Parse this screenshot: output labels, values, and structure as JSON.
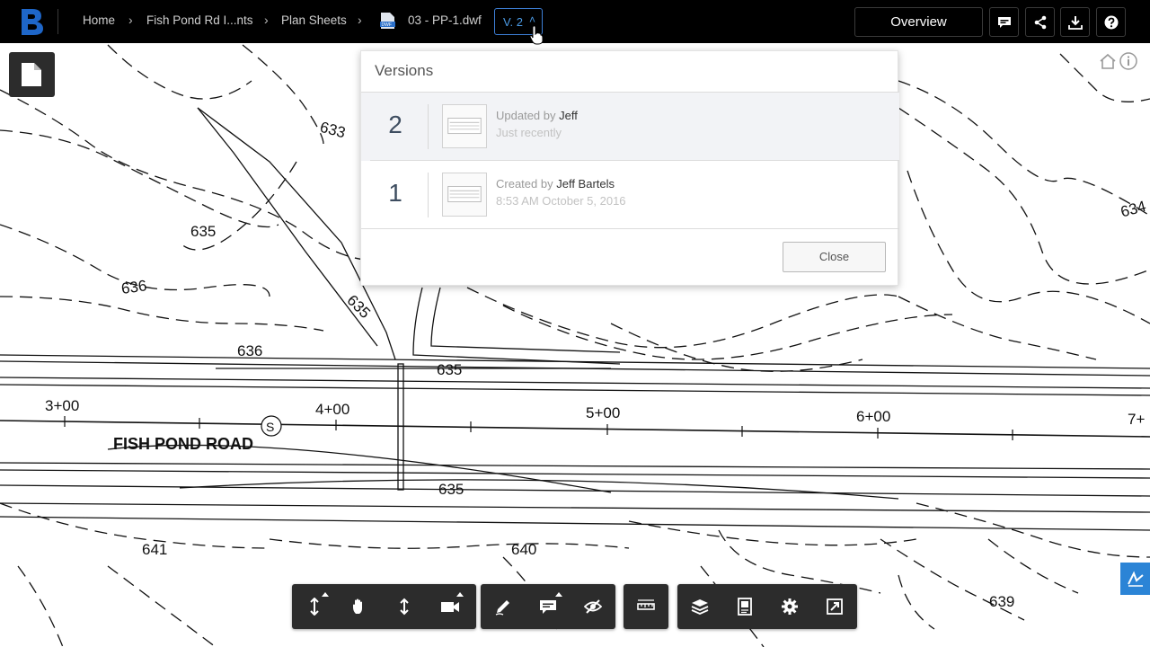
{
  "header": {
    "logo": "bentley-b-logo",
    "breadcrumbs": [
      "Home",
      "Fish Pond Rd I...nts",
      "Plan Sheets"
    ],
    "file_name": "03 - PP-1.dwf",
    "file_type": "DWF",
    "version_label": "V. 2",
    "overview_label": "Overview",
    "icons": [
      "comment-icon",
      "share-icon",
      "download-icon",
      "help-icon"
    ]
  },
  "versions_panel": {
    "title": "Versions",
    "items": [
      {
        "number": "2",
        "action": "Updated by",
        "user": "Jeff",
        "time": "Just recently"
      },
      {
        "number": "1",
        "action": "Created by",
        "user": "Jeff Bartels",
        "time": "8:53 AM October 5, 2016"
      }
    ],
    "close_label": "Close"
  },
  "drawing": {
    "road_name": "FISH POND ROAD",
    "contour_labels": [
      "633",
      "635",
      "636",
      "635",
      "636",
      "635",
      "635",
      "641",
      "640",
      "639",
      "634"
    ],
    "stations": [
      "3+00",
      "4+00",
      "5+00",
      "6+00",
      "7+"
    ],
    "survey_marker": "S"
  },
  "toolbar": {
    "groups": [
      [
        "orbit-icon",
        "pan-hand-icon",
        "zoom-icon",
        "camera-icon"
      ],
      [
        "pen-icon",
        "comment-icon",
        "hide-icon"
      ],
      [
        "measure-icon"
      ],
      [
        "layers-icon",
        "properties-icon",
        "settings-icon",
        "fullscreen-icon"
      ]
    ]
  }
}
